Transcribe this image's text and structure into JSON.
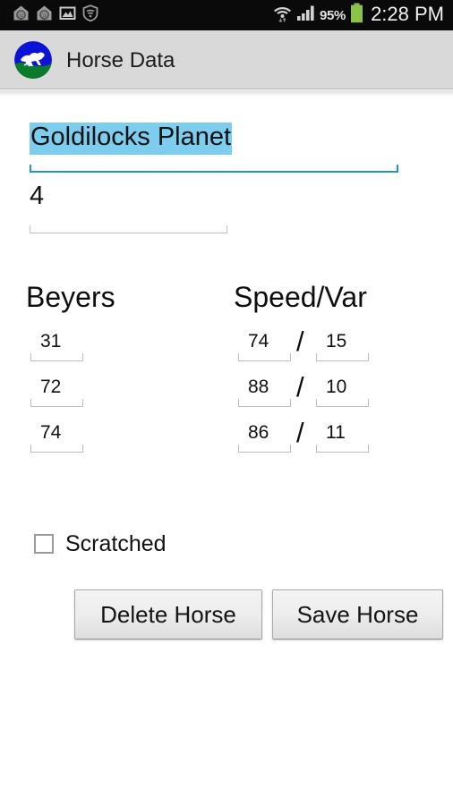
{
  "status_bar": {
    "left_icons": [
      "app-badge-icon",
      "app-badge-icon",
      "image-icon",
      "shield-icon"
    ],
    "wifi_icon": "wifi-transfer-icon",
    "signal_icon": "cellular-signal-icon",
    "battery_percent": "95%",
    "battery_icon": "battery-full-icon",
    "clock": "2:28 PM",
    "colors": {
      "background": "#0a0a0a",
      "text": "#f2f2f2",
      "battery": "#8bc34a"
    }
  },
  "action_bar": {
    "logo_icon": "horse-logo-icon",
    "title": "Horse Data",
    "colors": {
      "background": "#d9d9d9",
      "title": "#1b1b1b"
    }
  },
  "form": {
    "horse_name": {
      "value": "Goldilocks Planet",
      "placeholder": "Horse Name",
      "selected": true,
      "focused": true
    },
    "horse_number": {
      "value": "4",
      "placeholder": "Number",
      "selected": false,
      "focused": false
    },
    "headings": {
      "beyers": "Beyers",
      "speed_var": "Speed/Var"
    },
    "separator": "/",
    "rows": [
      {
        "beyer": "31",
        "speed": "74",
        "var": "15"
      },
      {
        "beyer": "72",
        "speed": "88",
        "var": "10"
      },
      {
        "beyer": "74",
        "speed": "86",
        "var": "11"
      }
    ],
    "scratched": {
      "label": "Scratched",
      "checked": false
    },
    "buttons": {
      "delete": "Delete Horse",
      "save": "Save Horse"
    }
  },
  "colors": {
    "selection_highlight": "#7ccdee",
    "focused_underline": "#2196c4",
    "unfocused_underline": "#bdbdbd",
    "page_background": "#ffffff",
    "text": "#111111"
  }
}
